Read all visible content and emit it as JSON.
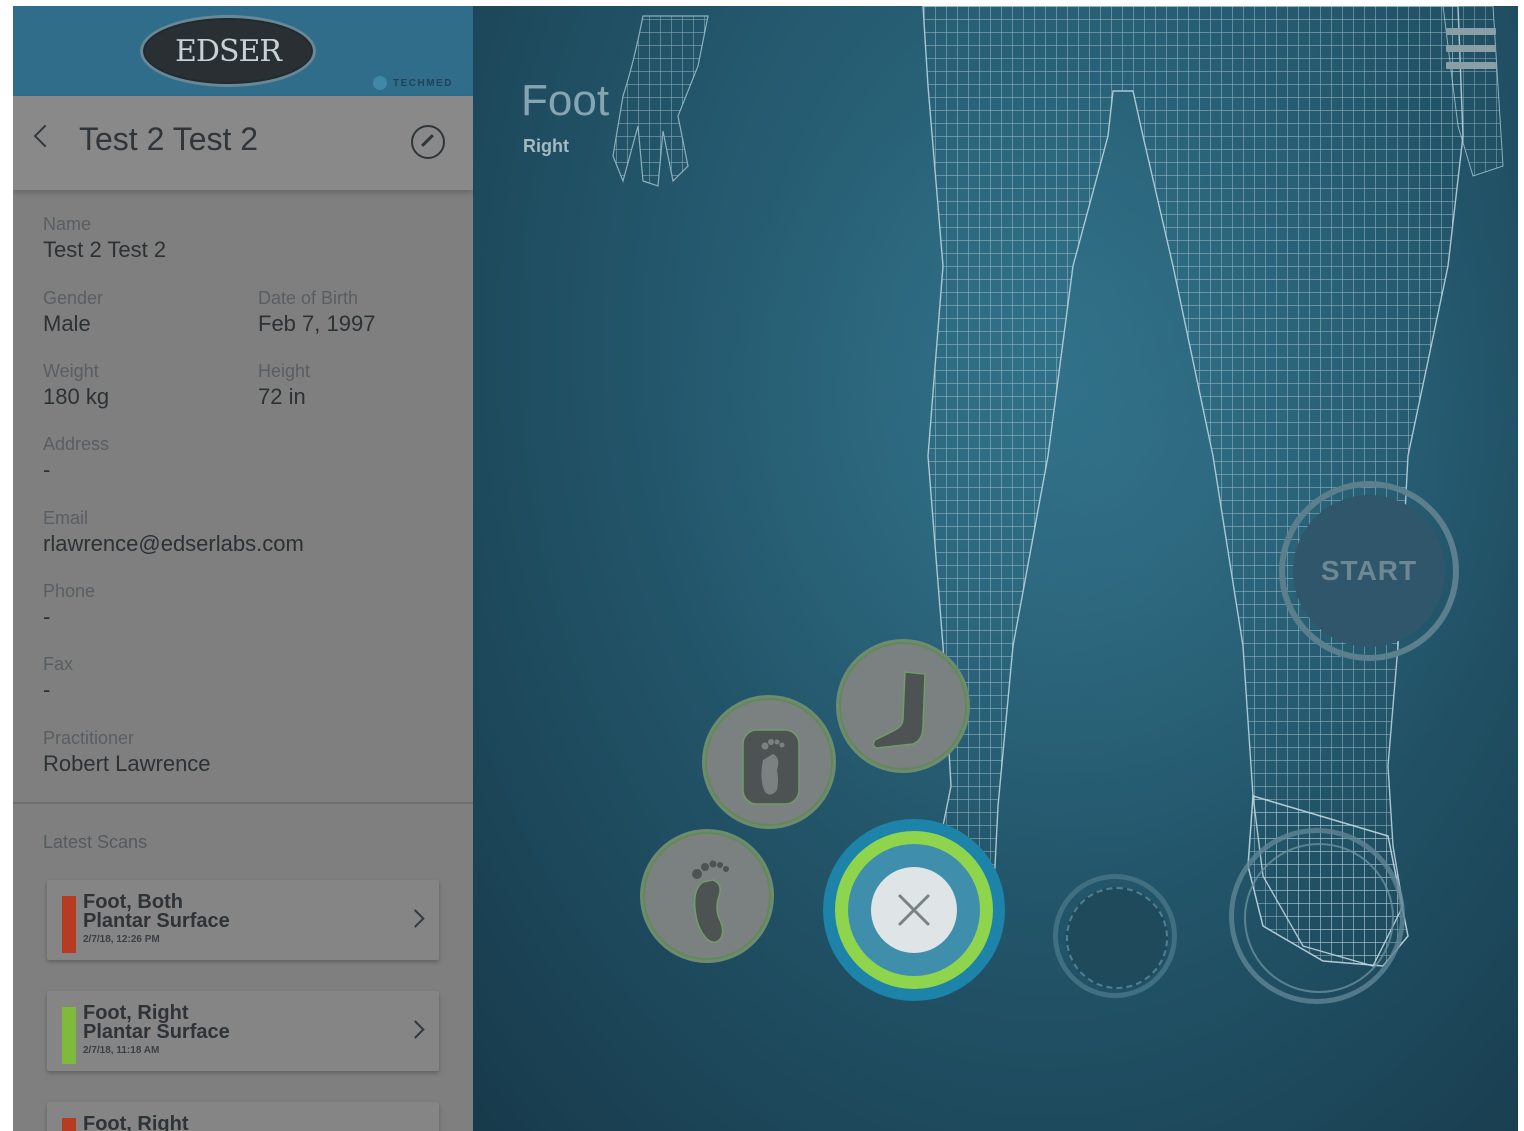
{
  "logo": {
    "text": "EDSER",
    "partner": "TECHMED"
  },
  "patient": {
    "title": "Test 2 Test 2",
    "fields": {
      "name": {
        "label": "Name",
        "value": "Test 2 Test 2"
      },
      "gender": {
        "label": "Gender",
        "value": "Male"
      },
      "dob": {
        "label": "Date of Birth",
        "value": "Feb 7, 1997"
      },
      "weight": {
        "label": "Weight",
        "value": "180 kg"
      },
      "height": {
        "label": "Height",
        "value": "72 in"
      },
      "address": {
        "label": "Address",
        "value": "-"
      },
      "email": {
        "label": "Email",
        "value": "rlawrence@edserlabs.com"
      },
      "phone": {
        "label": "Phone",
        "value": "-"
      },
      "fax": {
        "label": "Fax",
        "value": "-"
      },
      "practitioner": {
        "label": "Practitioner",
        "value": "Robert Lawrence"
      }
    }
  },
  "latest_scans": {
    "label": "Latest Scans",
    "items": [
      {
        "title_line1": "Foot, Both",
        "title_line2": "Plantar Surface",
        "date": "2/7/18, 12:26 PM",
        "color": "#b73a22"
      },
      {
        "title_line1": "Foot, Right",
        "title_line2": "Plantar Surface",
        "date": "2/7/18, 11:18 AM",
        "color": "#7fba3c"
      },
      {
        "title_line1": "Foot, Right",
        "title_line2": "",
        "date": "",
        "color": "#b73a22"
      }
    ]
  },
  "region": {
    "title": "Foot",
    "side": "Right"
  },
  "start_button": {
    "label": "START"
  },
  "scan_options": [
    {
      "icon": "foot-plantar-icon"
    },
    {
      "icon": "foot-sole-box-icon"
    },
    {
      "icon": "foot-side-icon"
    }
  ],
  "colors": {
    "accent_blue": "#1d83a8",
    "accent_green": "#8fd44d",
    "panel_gray": "#7f7f7f"
  }
}
